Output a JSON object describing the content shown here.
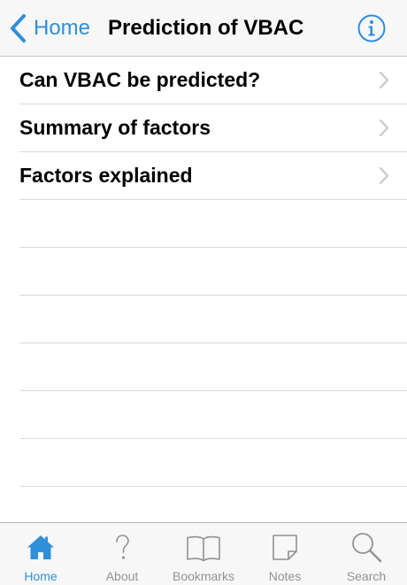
{
  "navbar": {
    "back_label": "Home",
    "title": "Prediction of VBAC",
    "info_icon": "info-icon"
  },
  "list": {
    "items": [
      {
        "label": "Can VBAC be predicted?"
      },
      {
        "label": "Summary of factors"
      },
      {
        "label": "Factors explained"
      }
    ]
  },
  "tabbar": {
    "tabs": [
      {
        "label": "Home",
        "icon": "home-icon",
        "active": true
      },
      {
        "label": "About",
        "icon": "question-icon",
        "active": false
      },
      {
        "label": "Bookmarks",
        "icon": "book-icon",
        "active": false
      },
      {
        "label": "Notes",
        "icon": "note-icon",
        "active": false
      },
      {
        "label": "Search",
        "icon": "search-icon",
        "active": false
      }
    ]
  },
  "colors": {
    "accent": "#2f8fd8",
    "inactive": "#929292",
    "separator": "#d9d9de",
    "bar_background": "#f7f7f8"
  }
}
